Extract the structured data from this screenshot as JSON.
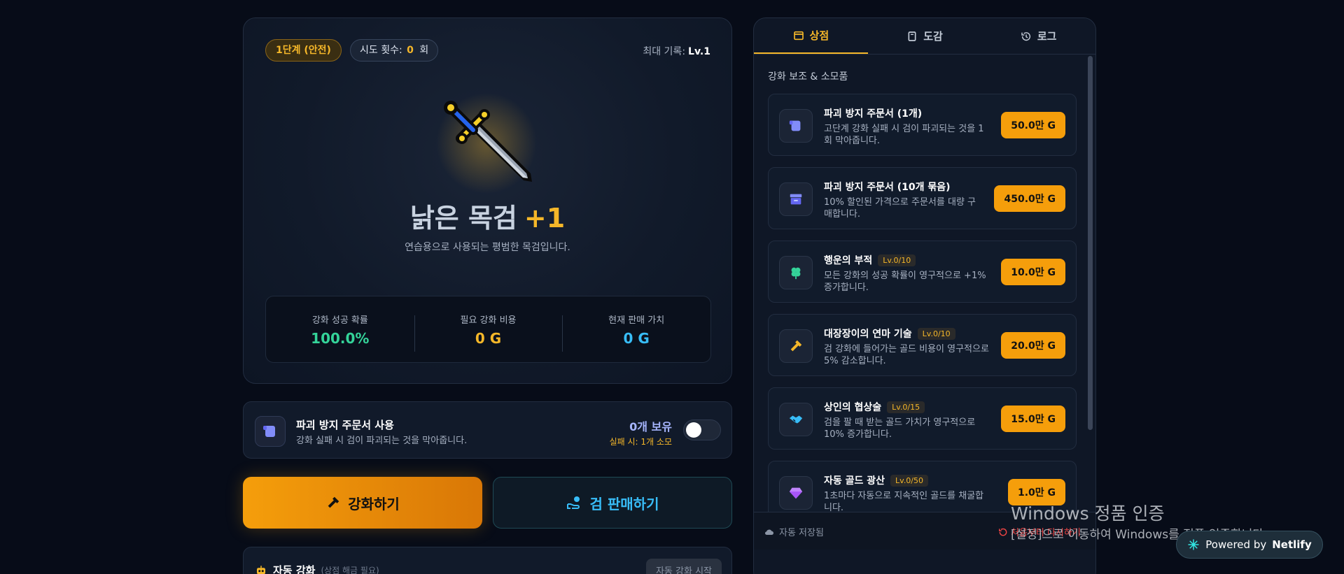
{
  "status": {
    "stage_badge": "1단계 (안전)",
    "tries_label": "시도 횟수:",
    "tries_value": "0",
    "tries_unit": "회",
    "max_record_label": "최대 기록:",
    "max_record_value": "Lv.1"
  },
  "sword": {
    "name": "낡은 목검",
    "level": "+1",
    "description": "연습용으로 사용되는 평범한 목검입니다."
  },
  "stats": [
    {
      "label": "강화 성공 확률",
      "value": "100.0%",
      "color": "#34d399"
    },
    {
      "label": "필요 강화 비용",
      "value": "0 G",
      "color": "#f5b729"
    },
    {
      "label": "현재 판매 가치",
      "value": "0 G",
      "color": "#38bdf8"
    }
  ],
  "scroll_option": {
    "title": "파괴 방지 주문서 사용",
    "subtitle": "강화 실패 시 검이 파괴되는 것을 막아줍니다.",
    "owned": "0개 보유",
    "consume_note": "실패 시: 1개 소모",
    "enabled": false
  },
  "actions": {
    "enhance_label": "강화하기",
    "sell_label": "검 판매하기"
  },
  "auto_enhance": {
    "label": "자동 강화",
    "note": "(상점 해금 필요)",
    "button_label": "자동 강화 시작"
  },
  "tabs": [
    {
      "label": "상점",
      "icon": "store-icon",
      "active": true
    },
    {
      "label": "도감",
      "icon": "book-icon",
      "active": false
    },
    {
      "label": "로그",
      "icon": "history-icon",
      "active": false
    }
  ],
  "shop": {
    "section_title": "강화 보조 & 소모품",
    "items": [
      {
        "title": "파괴 방지 주문서 (1개)",
        "level": "",
        "desc": "고단계 강화 실패 시 검이 파괴되는 것을 1회 막아줍니다.",
        "price": "50.0만 G",
        "icon": "scroll-icon",
        "icon_color": "#818cf8"
      },
      {
        "title": "파괴 방지 주문서 (10개 묶음)",
        "level": "",
        "desc": "10% 할인된 가격으로 주문서를 대량 구매합니다.",
        "price": "450.0만 G",
        "icon": "archive-box-icon",
        "icon_color": "#818cf8"
      },
      {
        "title": "행운의 부적",
        "level": "Lv.0/10",
        "desc": "모든 강화의 성공 확률이 영구적으로 +1% 증가합니다.",
        "price": "10.0만 G",
        "icon": "clover-icon",
        "icon_color": "#34d399"
      },
      {
        "title": "대장장이의 연마 기술",
        "level": "Lv.0/10",
        "desc": "검 강화에 들어가는 골드 비용이 영구적으로 5% 감소합니다.",
        "price": "20.0만 G",
        "icon": "hammer-icon",
        "icon_color": "#f5b729"
      },
      {
        "title": "상인의 협상술",
        "level": "Lv.0/15",
        "desc": "검을 팔 때 받는 골드 가치가 영구적으로 10% 증가합니다.",
        "price": "15.0만 G",
        "icon": "handshake-icon",
        "icon_color": "#38bdf8"
      },
      {
        "title": "자동 골드 광산",
        "level": "Lv.0/50",
        "desc": "1초마다 자동으로 지속적인 골드를 채굴합니다.",
        "price": "1.0만 G",
        "icon": "gem-icon",
        "icon_color": "#c084fc"
      }
    ]
  },
  "footer": {
    "autosave": "자동 저장됨",
    "reset": "처음부터 다시하기"
  },
  "watermark": {
    "title": "Windows 정품 인증",
    "subtitle": "[설정]으로 이동하여 Windows를 정품 인증합니다."
  },
  "netlify": {
    "prefix": "Powered by",
    "brand": "Netlify"
  }
}
